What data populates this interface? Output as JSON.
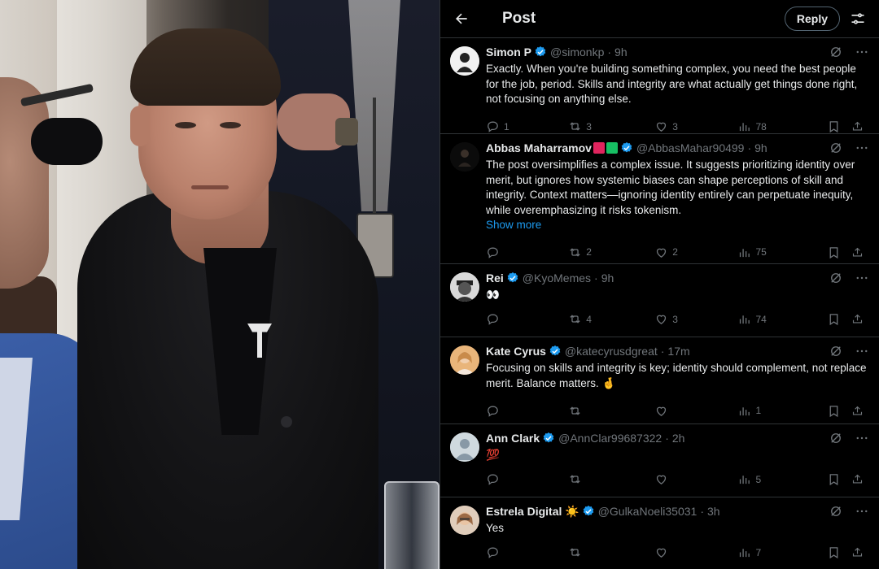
{
  "header": {
    "title": "Post",
    "reply_label": "Reply"
  },
  "colors": {
    "accent": "#1d9bf0",
    "text": "#e7e9ea",
    "muted": "#71767b",
    "border": "#2f3336"
  },
  "replies": [
    {
      "name": "Simon P",
      "handle": "@simonkp",
      "time": "9h",
      "text": "Exactly. When you're building something complex, you need the best people for the job, period. Skills and integrity are what actually get things done right, not focusing on anything else.",
      "counts": {
        "replies": "1",
        "reposts": "3",
        "likes": "3",
        "views": "78"
      }
    },
    {
      "name": "Abbas Maharramov",
      "handle": "@AbbasMahar90499",
      "time": "9h",
      "flags": "🟥🟩",
      "text": "The post oversimplifies a complex issue. It suggests prioritizing identity over merit, but ignores how systemic biases can shape perceptions of skill and integrity. Context matters—ignoring identity entirely can perpetuate inequity, while overemphasizing it risks tokenism.",
      "show_more": "Show more",
      "counts": {
        "replies": "",
        "reposts": "2",
        "likes": "2",
        "views": "75"
      }
    },
    {
      "name": "Rei",
      "handle": "@KyoMemes",
      "time": "9h",
      "text": "👀",
      "counts": {
        "replies": "",
        "reposts": "4",
        "likes": "3",
        "views": "74"
      }
    },
    {
      "name": "Kate Cyrus",
      "handle": "@katecyrusdgreat",
      "time": "17m",
      "text": "Focusing on skills and integrity is key; identity should complement, not replace merit. Balance matters. 🤞",
      "counts": {
        "replies": "",
        "reposts": "",
        "likes": "",
        "views": "1"
      }
    },
    {
      "name": "Ann Clark",
      "handle": "@AnnClar99687322",
      "time": "2h",
      "text": "💯",
      "counts": {
        "replies": "",
        "reposts": "",
        "likes": "",
        "views": "5"
      }
    },
    {
      "name": "Estrela Digital ☀️",
      "handle": "@GulkaNoeli35031",
      "time": "3h",
      "text": "Yes",
      "counts": {
        "replies": "",
        "reposts": "",
        "likes": "",
        "views": "7"
      }
    }
  ]
}
